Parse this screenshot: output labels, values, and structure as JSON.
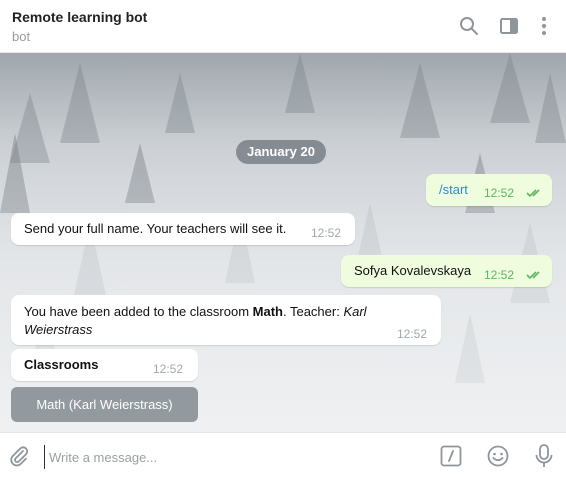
{
  "header": {
    "title": "Remote learning bot",
    "subtitle": "bot",
    "icons": [
      "search-icon",
      "sidebar-toggle-icon",
      "more-vertical-icon"
    ]
  },
  "chat": {
    "date": "January 20",
    "messages": [
      {
        "direction": "out",
        "text": "/start",
        "time": "12:52",
        "read": true
      },
      {
        "direction": "in",
        "text": "Send your full name. Your teachers will see it.",
        "time": "12:52"
      },
      {
        "direction": "out",
        "text": "Sofya Kovalevskaya",
        "time": "12:52",
        "read": true
      },
      {
        "direction": "in",
        "text_prefix": "You have been added to the classroom ",
        "text_bold": "Math",
        "text_mid": ". Teacher: ",
        "text_italic": "Karl Weierstrass",
        "time": "12:52"
      },
      {
        "direction": "in",
        "text_bold": "Classrooms",
        "time": "12:52"
      }
    ],
    "keyboard_buttons": [
      "Math (Karl Weierstrass)"
    ]
  },
  "composer": {
    "placeholder": "Write a message...",
    "icons": [
      "attach-icon",
      "bot-command-icon",
      "emoji-icon",
      "microphone-icon"
    ]
  },
  "colors": {
    "incoming_bubble": "#ffffff",
    "outgoing_bubble": "#effdde",
    "command_link": "#2a8ad2",
    "read_ticks": "#5eb75e"
  }
}
